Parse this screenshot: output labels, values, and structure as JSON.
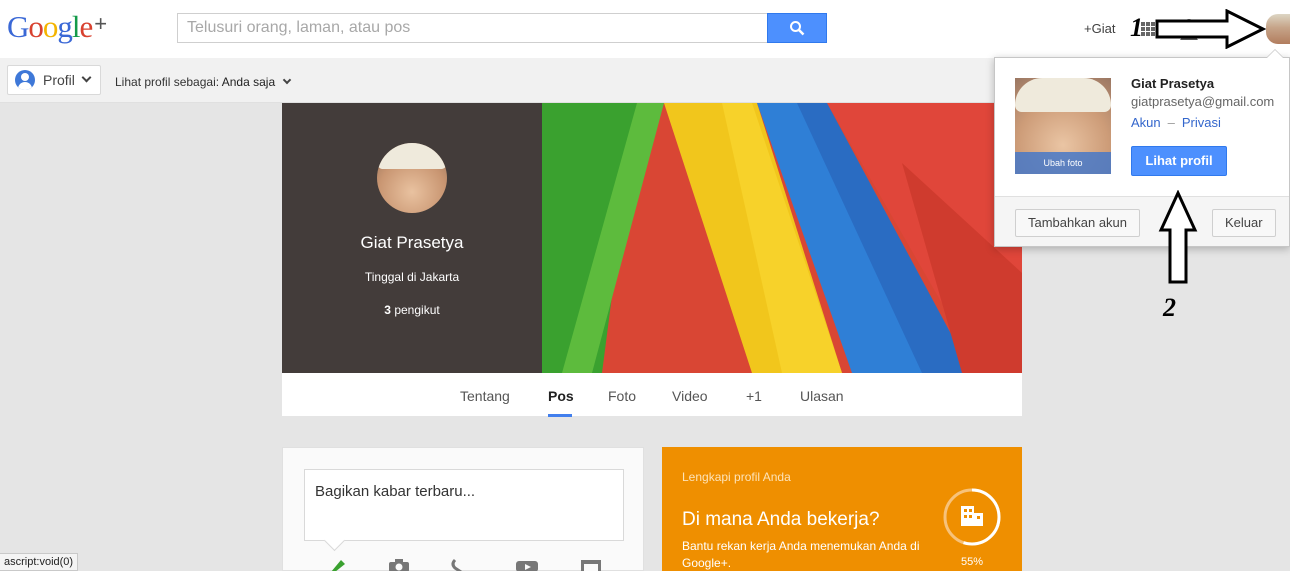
{
  "header": {
    "logo_text": "Google+",
    "search_placeholder": "Telusuri orang, laman, atau pos",
    "user_link": "+Giat",
    "annotation_1": "1"
  },
  "subbar": {
    "profile_button": "Profil",
    "view_as_label": "Lihat profil sebagai:",
    "view_as_value": "Anda saja"
  },
  "profile": {
    "name": "Giat Prasetya",
    "location": "Tinggal di Jakarta",
    "followers_count": "3",
    "followers_label": "pengikut"
  },
  "tabs": [
    {
      "label": "Tentang"
    },
    {
      "label": "Pos"
    },
    {
      "label": "Foto"
    },
    {
      "label": "Video"
    },
    {
      "label": "+1"
    },
    {
      "label": "Ulasan"
    }
  ],
  "active_tab": "Pos",
  "share": {
    "placeholder": "Bagikan kabar terbaru..."
  },
  "profile_prompt": {
    "title": "Lengkapi profil Anda",
    "question": "Di mana Anda bekerja?",
    "description": "Bantu rekan kerja Anda menemukan Anda di Google+.",
    "progress_label": "55%",
    "progress_value": 0.55
  },
  "account_menu": {
    "change_photo": "Ubah foto",
    "name": "Giat Prasetya",
    "email": "giatprasetya@gmail.com",
    "account_link": "Akun",
    "privacy_link": "Privasi",
    "view_profile_button": "Lihat profil",
    "add_account_button": "Tambahkan akun",
    "sign_out_button": "Keluar",
    "annotation_2": "2"
  },
  "status_bar_text": "ascript:void(0)",
  "colors": {
    "accent_blue": "#4d90fe",
    "cover_dark": "#433c3a",
    "prompt_orange": "#ef8f00"
  }
}
